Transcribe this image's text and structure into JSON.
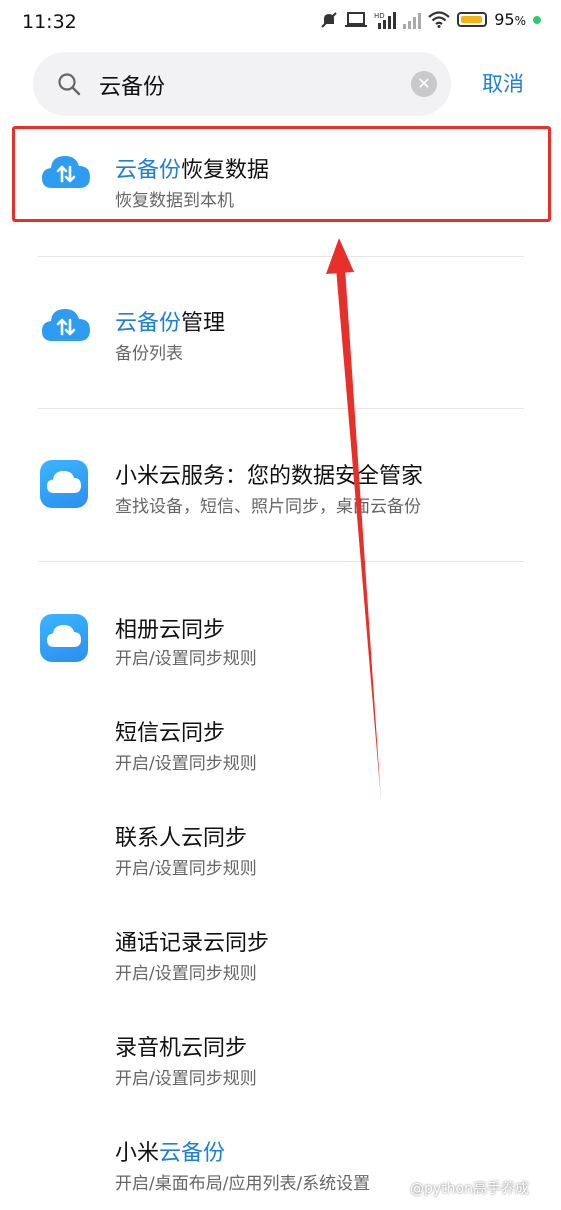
{
  "status_bar": {
    "time": "11:32",
    "battery_percent_label": "95",
    "battery_level": 0.95,
    "icons": [
      "mute-icon",
      "laptop-icon",
      "hd-signal-icon",
      "signal-icon",
      "wifi-icon",
      "battery-icon"
    ]
  },
  "search": {
    "value": "云备份",
    "cancel_label": "取消"
  },
  "results": [
    {
      "title_highlight": "云备份",
      "title_rest": "恢复数据",
      "subtitle": "恢复数据到本机",
      "icon": "cloud-backup-icon"
    },
    {
      "title_highlight": "云备份",
      "title_rest": "管理",
      "subtitle": "备份列表",
      "icon": "cloud-backup-icon"
    },
    {
      "title": "小米云服务：您的数据安全管家",
      "subtitle": "查找设备，短信、照片同步，桌面云备份",
      "icon": "xiaomi-cloud-app-icon"
    },
    {
      "title": "相册云同步",
      "subtitle": "开启/设置同步规则",
      "icon": "xiaomi-cloud-app-icon"
    },
    {
      "title": "短信云同步",
      "subtitle": "开启/设置同步规则"
    },
    {
      "title": "联系人云同步",
      "subtitle": "开启/设置同步规则"
    },
    {
      "title": "通话记录云同步",
      "subtitle": "开启/设置同步规则"
    },
    {
      "title": "录音机云同步",
      "subtitle": "开启/设置同步规则"
    },
    {
      "title_prefix": "小米",
      "title_highlight": "云备份",
      "subtitle": "开启/桌面布局/应用列表/系统设置"
    }
  ],
  "watermark": "@python高手养成",
  "colors": {
    "accent": "#1e7fd6",
    "annotation": "#e8302b",
    "battery": "#f3b319"
  }
}
